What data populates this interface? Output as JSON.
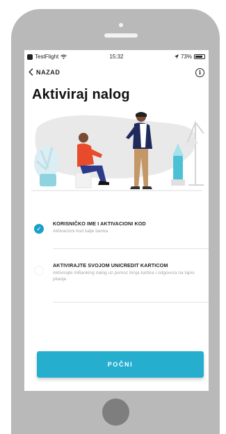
{
  "status_bar": {
    "carrier": "TestFlight",
    "time": "15:32",
    "battery": "73%"
  },
  "nav": {
    "back_label": "NAZAD",
    "info_symbol": "i"
  },
  "page_title": "Aktiviraj nalog",
  "options": [
    {
      "title": "KORISNIČKO IME I AKTIVACIONI KOD",
      "subtitle": "Aktivacioni kod šalje banka",
      "selected": true
    },
    {
      "title": "AKTIVIRAJTE SVOJOM UNICREDIT KARTICOM",
      "subtitle": "Aktivirajte mBanking nalog uz pomoć broja kartice i odgovora na tajno pitanje",
      "selected": false
    }
  ],
  "start_button": "POČNI",
  "icons": {
    "back": "chevron-left-icon",
    "info": "info-icon",
    "check": "check-icon",
    "wifi": "wifi-icon",
    "battery": "battery-icon",
    "location": "location-icon"
  },
  "colors": {
    "accent": "#26aecf",
    "check": "#1aa0c7",
    "phone_frame": "#b9b9b9",
    "home_button": "#7e7e7e"
  }
}
